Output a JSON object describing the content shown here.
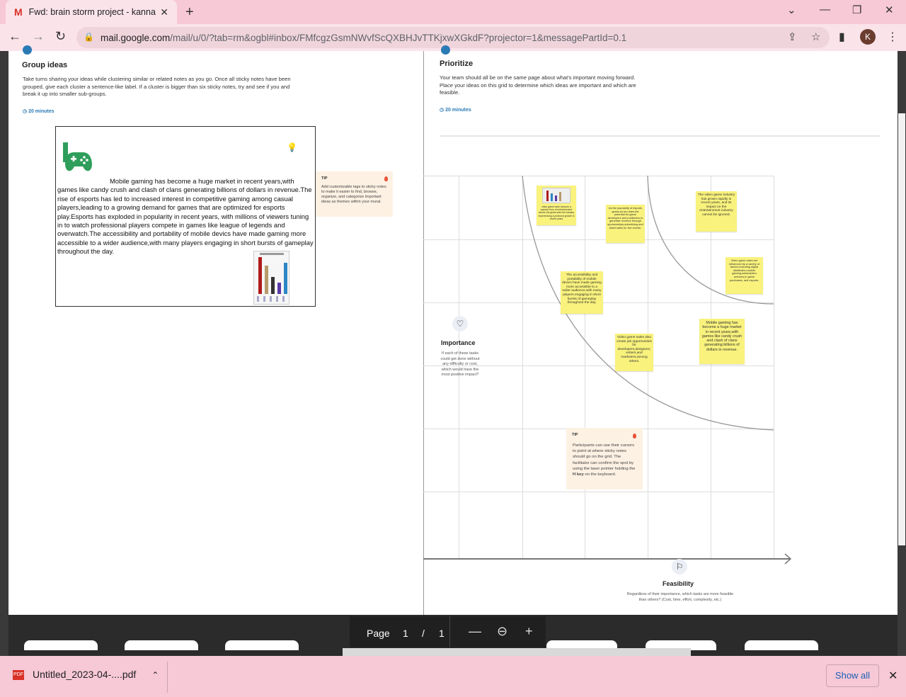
{
  "browser": {
    "tab_title": "Fwd: brain storm project - kanna",
    "tab_icon": "M",
    "url_domain": "mail.google.com",
    "url_path": "/mail/u/0/?tab=rm&ogbl#inbox/FMfcgzGsmNWvfScQXBHJvTTKjxwXGkdF?projector=1&messagePartId=0.1",
    "avatar_letter": "K"
  },
  "left": {
    "title": "Group ideas",
    "desc": "Take turns sharing your ideas while clustering similar or related notes as you go. Once all sticky notes have been grouped, give each cluster a sentence-like label. If a cluster is bigger than six sticky notes, try and see if you and break it up into smaller sub-groups.",
    "timer": "20 minutes",
    "card_text": "Mobile gaming has become a huge market in recent years,with games like candy crush and clash of clans generating billions of dollars in revenue.The rise of esports has led to increased interest in competitive gaming among casual players,leading to a growing demand for games that are optimized for esports play.Esports has exploded in popularity in recent years, with millions of viewers tuning in to watch professional players compete in games like league of legends and overwatch.The accessibility and portability of mobile devics have made gaming more accessible to a wider audience,with many players engaging in short bursts of gameplay throughout  the day.",
    "tip_label": "TIP",
    "tip_text": "Add customizable tags to sticky notes to make it easier to find, browse, organize, and categorize important ideas as themes within your mural."
  },
  "right": {
    "title": "Prioritize",
    "desc": "Your team should all be on the same page about what's important moving forward. Place your ideas on this grid to determine which ideas are important and which are feasible.",
    "timer": "20 minutes",
    "importance_label": "Importance",
    "importance_desc": "If each of these tasks could get done without any difficulty or cost, which would have the most positive impact?",
    "feasibility_label": "Feasibility",
    "feasibility_desc": "Regardless of their importance, which tasks are more feasible than others? (Cost, time, effort, complexity, etc.)",
    "tip_label": "TIP",
    "tip_text_a": "Participants can use their cursors to point at where sticky notes should go on the grid. The facilitator can confirm the spot by using the laser pointer holding the ",
    "tip_text_key": "H key",
    "tip_text_b": " on the keyboard.",
    "notes": [
      "video game have become a popular from of entertainment across the globe,with the industry experiencing a profound growth in recent years",
      "As the popularity of esports grows,so too does the potential for game developers and publishers to generate revenue through sponsorships,advertising and ticket sales for live events.",
      "The video game industry has grown rapidly in recent years, and its impact on the entertainment industry cannot be ignored.",
      "Video game sales are influenced by a variety of factors,including digital distribution,mobile gaming,subscription services,in game purchases, and esports.",
      "The accessibility and portability of mobile devics have made gaming more accessible to a wider audience,with many players engaging in short bursts of gameplay throughout the day.",
      "Video game sales also create job opportunities for developers,designers, writers,and marketers,among others.",
      "Mobile gaming has become a huge market in recent years,with games like candy crush and clash of clans generating billions of dollars in revenue."
    ]
  },
  "pdf": {
    "page_label": "Page",
    "page_current": "1",
    "page_sep": "/",
    "page_total": "1"
  },
  "downloads": {
    "file": "Untitled_2023-04-....pdf",
    "show_all": "Show all"
  }
}
